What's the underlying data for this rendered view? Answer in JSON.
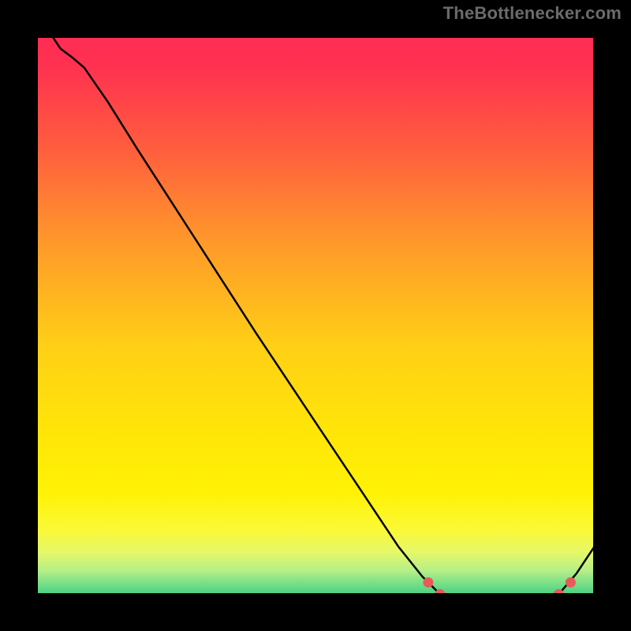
{
  "watermark": "TheBottlenecker.com",
  "colors": {
    "top": "#ff2a55",
    "middle": "#ffe103",
    "green_edge": "#2cd47c",
    "green_core": "#0fb760",
    "line": "#000000",
    "marker": "#e85a5a",
    "black": "#000000"
  },
  "chart_data": {
    "type": "line",
    "title": "",
    "xlabel": "",
    "ylabel": "",
    "xlim": [
      0,
      100
    ],
    "ylim": [
      0,
      100
    ],
    "series": [
      {
        "name": "curve",
        "points": [
          {
            "x": 3.0,
            "y": 100.0
          },
          {
            "x": 5.0,
            "y": 98.0
          },
          {
            "x": 7.0,
            "y": 95.0
          },
          {
            "x": 9.0,
            "y": 93.5
          },
          {
            "x": 11.0,
            "y": 91.8
          },
          {
            "x": 15.0,
            "y": 86.0
          },
          {
            "x": 20.0,
            "y": 78.0
          },
          {
            "x": 30.0,
            "y": 62.5
          },
          {
            "x": 40.0,
            "y": 47.0
          },
          {
            "x": 50.0,
            "y": 32.0
          },
          {
            "x": 58.0,
            "y": 20.0
          },
          {
            "x": 64.0,
            "y": 11.0
          },
          {
            "x": 68.0,
            "y": 6.0
          },
          {
            "x": 71.0,
            "y": 3.0
          },
          {
            "x": 75.0,
            "y": 0.8
          },
          {
            "x": 80.0,
            "y": 0.3
          },
          {
            "x": 85.0,
            "y": 0.3
          },
          {
            "x": 88.0,
            "y": 0.8
          },
          {
            "x": 91.0,
            "y": 3.0
          },
          {
            "x": 94.0,
            "y": 6.5
          },
          {
            "x": 97.0,
            "y": 11.0
          }
        ]
      }
    ],
    "markers": [
      {
        "x": 69.0,
        "y": 5.0
      },
      {
        "x": 71.0,
        "y": 3.0
      },
      {
        "x": 72.5,
        "y": 1.7
      },
      {
        "x": 74.5,
        "y": 0.8
      },
      {
        "x": 76.0,
        "y": 0.4
      },
      {
        "x": 77.5,
        "y": 0.3
      },
      {
        "x": 79.0,
        "y": 0.3
      },
      {
        "x": 80.5,
        "y": 0.3
      },
      {
        "x": 82.0,
        "y": 0.3
      },
      {
        "x": 83.5,
        "y": 0.3
      },
      {
        "x": 85.0,
        "y": 0.3
      },
      {
        "x": 87.0,
        "y": 0.5
      },
      {
        "x": 91.0,
        "y": 3.0
      },
      {
        "x": 93.0,
        "y": 5.0
      }
    ]
  }
}
